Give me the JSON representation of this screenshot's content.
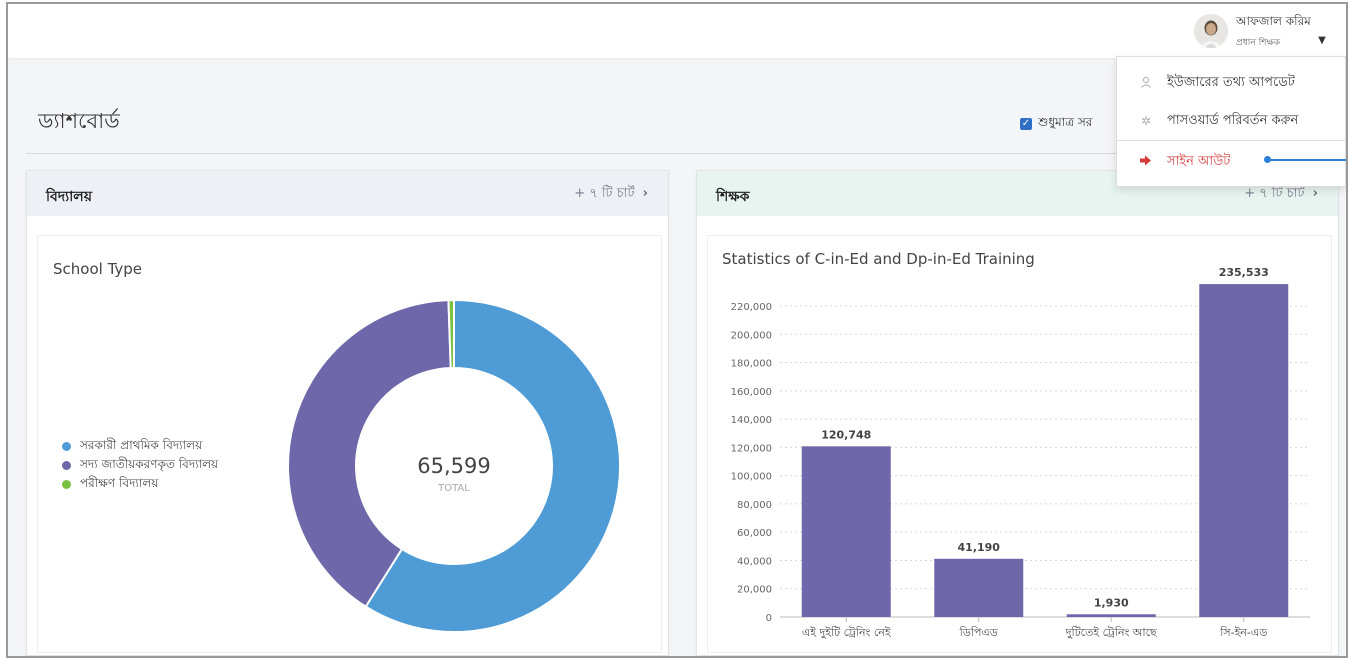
{
  "header": {
    "user_name": "আফজাল করিম",
    "user_role": "প্রধান শিক্ষক",
    "caret_icon": "caret-down-icon"
  },
  "page": {
    "title": "ড্যাশবোর্ড",
    "filter_label": "শুধুমাত্র সর",
    "filter_checked": true
  },
  "user_menu": {
    "items": [
      {
        "label": "ইউজারের তথ্য আপডেট",
        "icon": "user-icon"
      },
      {
        "label": "পাসওয়ার্ড পরিবর্তন করুন",
        "icon": "gear-icon"
      },
      {
        "label": "সাইন আউট",
        "icon": "sign-out-icon",
        "color": "#d43a3a"
      }
    ]
  },
  "cards": {
    "school": {
      "title": "বিদ্যালয়",
      "more_label": "+ ৭ টি চার্ট",
      "header_bg": "#eef0f6"
    },
    "teacher": {
      "title": "শিক্ষক",
      "more_label": "+ ৭ টি চার্ট",
      "header_bg": "#e8f4f0"
    }
  },
  "colors": {
    "blue": "#4e9bd6",
    "purple": "#6e68aa",
    "green": "#7cc142",
    "accent": "#2a7fd4"
  },
  "chart_data": [
    {
      "type": "pie",
      "variant": "donut",
      "title": "School Type",
      "center_value": "65,599",
      "center_label": "TOTAL",
      "legend_position": "left",
      "slices": [
        {
          "label": "সরকারী প্রাথমিক বিদ্যালয়",
          "value": 38650,
          "color": "#4e9bd6"
        },
        {
          "label": "সদ্য জাতীয়করণকৃত বিদ্যালয়",
          "value": 26600,
          "color": "#6e68aa"
        },
        {
          "label": "পরীক্ষণ বিদ্যালয়",
          "value": 349,
          "color": "#7cc142"
        }
      ]
    },
    {
      "type": "bar",
      "title": "Statistics of C-in-Ed and Dp-in-Ed Training",
      "categories": [
        "এই দুইটি ট্রেনিং নেই",
        "ডিপিএড",
        "দুটিতেই ট্রেনিং আছে",
        "সি-ইন-এড"
      ],
      "values": [
        120748,
        41190,
        1930,
        235533
      ],
      "value_labels": [
        "120,748",
        "41,190",
        "1,930",
        "235,533"
      ],
      "ylim": [
        0,
        220000
      ],
      "yticks": [
        "0",
        "20,000",
        "40,000",
        "60,000",
        "80,000",
        "100,000",
        "120,000",
        "140,000",
        "160,000",
        "180,000",
        "200,000",
        "220,000"
      ],
      "grid": true,
      "color": "#6e68aa"
    }
  ]
}
